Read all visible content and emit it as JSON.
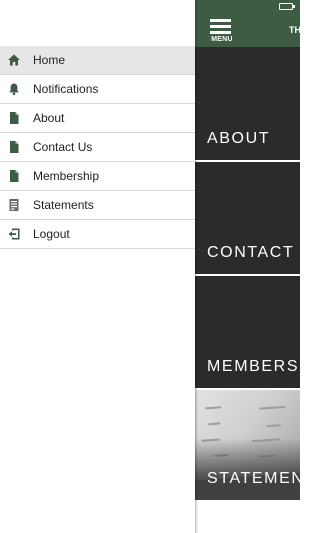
{
  "app": {
    "menu_label": "MENU",
    "title": "TH",
    "tiles": [
      {
        "label": "ABOUT"
      },
      {
        "label": "CONTACT U"
      },
      {
        "label": "MEMBERSH"
      },
      {
        "label": "STATEMEN"
      }
    ],
    "colors": {
      "primary": "#3e5c44",
      "tile": "#2b2b2b"
    }
  },
  "drawer": {
    "active_index": 0,
    "items": [
      {
        "label": "Home",
        "icon": "home-icon"
      },
      {
        "label": "Notifications",
        "icon": "bell-icon"
      },
      {
        "label": "About",
        "icon": "document-icon"
      },
      {
        "label": "Contact Us",
        "icon": "document-icon"
      },
      {
        "label": "Membership",
        "icon": "document-icon"
      },
      {
        "label": "Statements",
        "icon": "statement-icon"
      },
      {
        "label": "Logout",
        "icon": "logout-icon"
      }
    ],
    "icon_color": "#3e5c44"
  }
}
